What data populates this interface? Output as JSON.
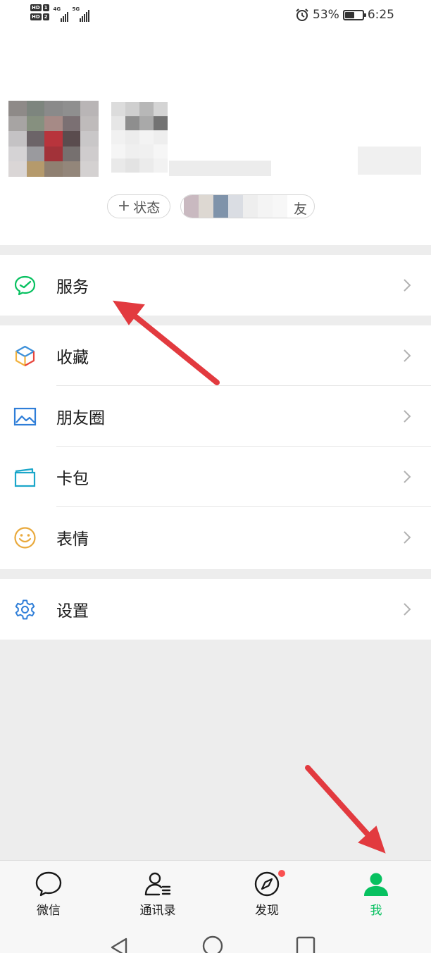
{
  "status_bar": {
    "hd1": "HD",
    "hd1_num": "1",
    "hd2": "HD",
    "hd2_num": "2",
    "net1": "4G",
    "net2": "5G",
    "battery_percent": "53%",
    "battery_level": 0.53,
    "time": "6:25"
  },
  "profile": {
    "status_button_label": "状态",
    "friends_button_label": "友"
  },
  "menu": {
    "services": "服务",
    "favorites": "收藏",
    "moments": "朋友圈",
    "cards": "卡包",
    "stickers": "表情",
    "settings": "设置"
  },
  "tabbar": {
    "chats": "微信",
    "contacts": "通讯录",
    "discover": "发现",
    "me": "我"
  },
  "colors": {
    "accent_green": "#07c160",
    "badge_red": "#fa5151",
    "annotation_arrow": "#e23a3f"
  }
}
